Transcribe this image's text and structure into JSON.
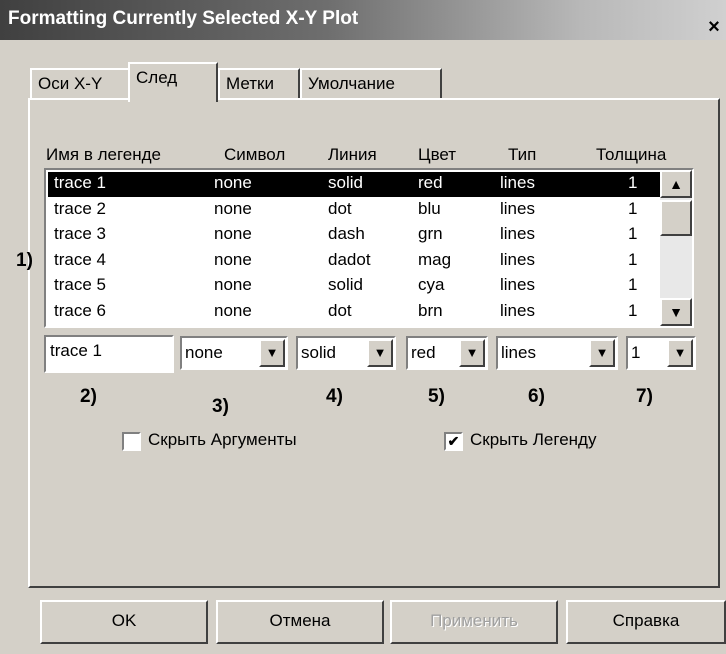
{
  "window": {
    "title": "Formatting Currently Selected X-Y Plot",
    "close_label": "×"
  },
  "tabs": [
    {
      "label": "Оси X-Y"
    },
    {
      "label": "След"
    },
    {
      "label": "Метки"
    },
    {
      "label": "Умолчание"
    }
  ],
  "columns": [
    "Имя в легенде",
    "Символ",
    "Линия",
    "Цвет",
    "Тип",
    "Толщина"
  ],
  "traces": [
    {
      "name": "trace 1",
      "symbol": "none",
      "line": "solid",
      "color": "red",
      "type": "lines",
      "weight": "1"
    },
    {
      "name": "trace 2",
      "symbol": "none",
      "line": "dot",
      "color": "blu",
      "type": "lines",
      "weight": "1"
    },
    {
      "name": "trace 3",
      "symbol": "none",
      "line": "dash",
      "color": "grn",
      "type": "lines",
      "weight": "1"
    },
    {
      "name": "trace 4",
      "symbol": "none",
      "line": "dadot",
      "color": "mag",
      "type": "lines",
      "weight": "1"
    },
    {
      "name": "trace 5",
      "symbol": "none",
      "line": "solid",
      "color": "cya",
      "type": "lines",
      "weight": "1"
    },
    {
      "name": "trace 6",
      "symbol": "none",
      "line": "dot",
      "color": "brn",
      "type": "lines",
      "weight": "1"
    }
  ],
  "selected_row": 0,
  "editors": {
    "name": "trace 1",
    "symbol": "none",
    "line": "solid",
    "color": "red",
    "type": "lines",
    "weight": "1"
  },
  "annotations": [
    "1)",
    "2)",
    "3)",
    "4)",
    "5)",
    "6)",
    "7)"
  ],
  "checkboxes": {
    "hide_args": {
      "label": "Скрыть Аргументы",
      "checked": false
    },
    "hide_legend": {
      "label": "Скрыть Легенду",
      "checked": true
    }
  },
  "buttons": {
    "ok": "OK",
    "cancel": "Отмена",
    "apply": "Применить",
    "help": "Справка"
  },
  "icons": {
    "scroll_up": "▲",
    "scroll_down": "▼",
    "dropdown": "▼",
    "check": "✔"
  }
}
